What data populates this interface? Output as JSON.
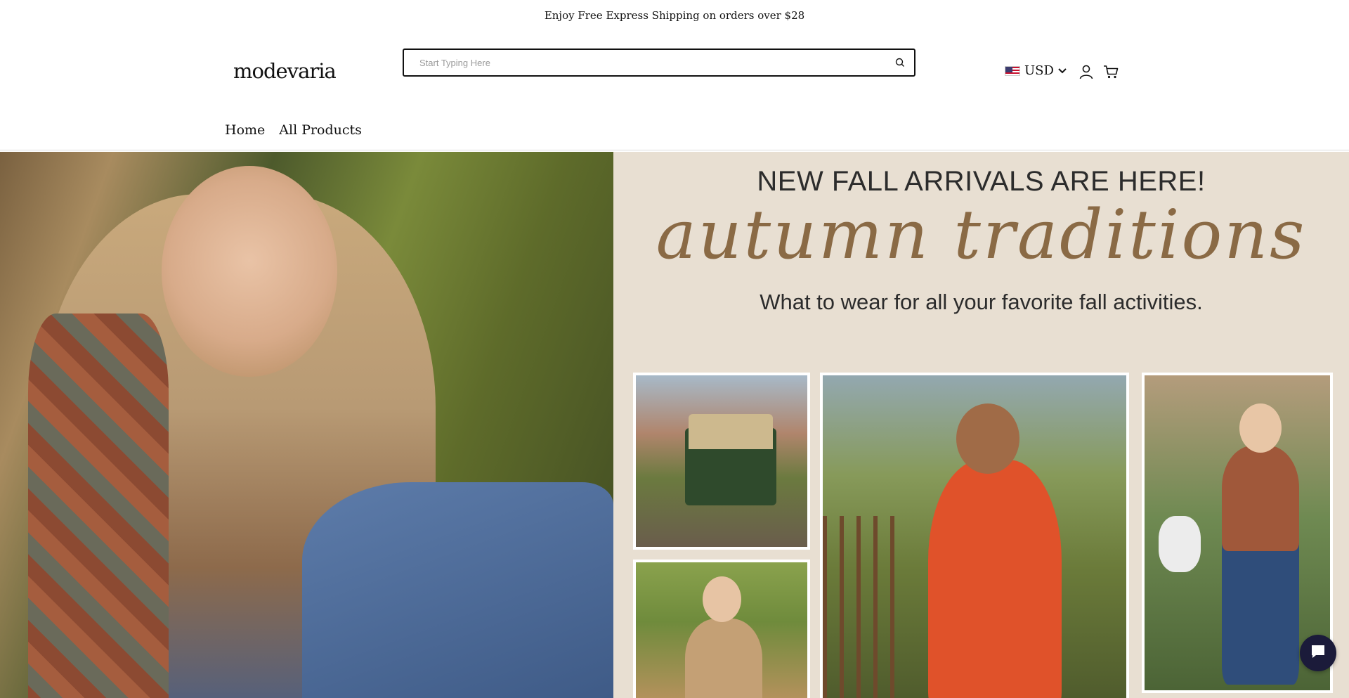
{
  "announcement": {
    "text": "Enjoy Free Express Shipping on orders over $28"
  },
  "header": {
    "logo_text": "modevaria",
    "search": {
      "placeholder": "Start Typing Here",
      "value": ""
    },
    "currency": {
      "code": "USD",
      "flag_icon": "us-flag-icon"
    },
    "account_icon": "user-icon",
    "cart_icon": "cart-icon"
  },
  "nav": {
    "items": [
      {
        "label": "Home"
      },
      {
        "label": "All Products"
      }
    ]
  },
  "hero": {
    "title": "NEW FALL ARRIVALS ARE HERE!",
    "script": "autumn traditions",
    "subtitle": "What to wear for all your favorite fall activities."
  },
  "chat": {
    "icon": "chat-bubble-icon"
  },
  "colors": {
    "hero_bg": "#e8dfd2",
    "script_brown": "#8a6a45",
    "chat_bg": "#1b1b3a"
  }
}
